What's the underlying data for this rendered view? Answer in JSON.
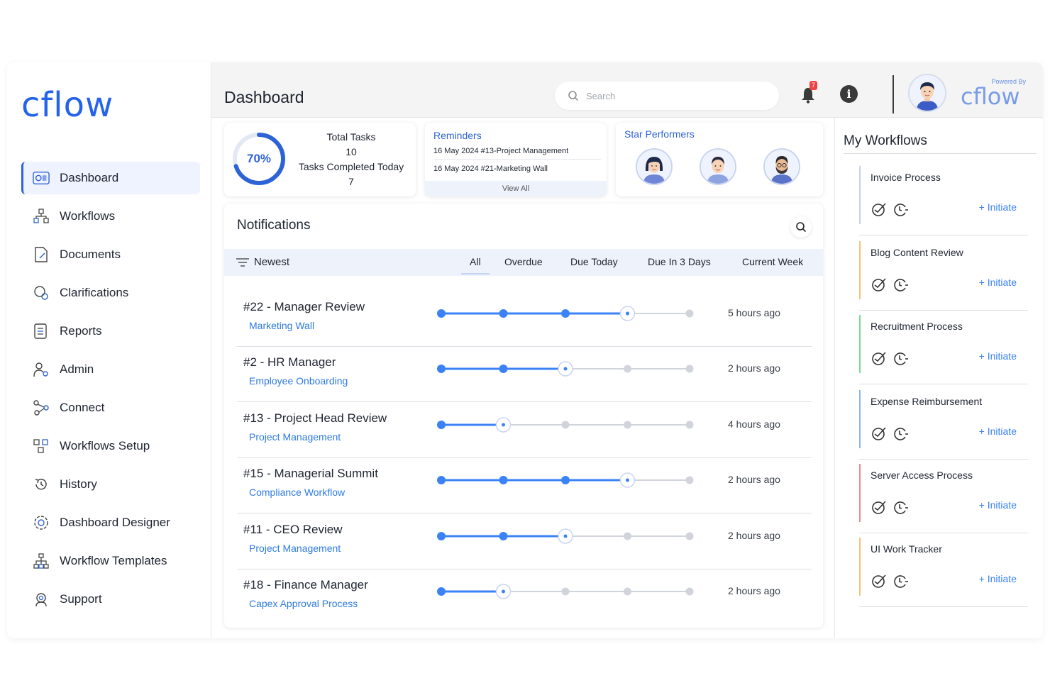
{
  "brand": {
    "logo": "cflow",
    "powered_by": "Powered By",
    "powered_logo": "cflow"
  },
  "sidebar": {
    "items": [
      {
        "label": "Dashboard",
        "icon": "dashboard-icon",
        "active": true
      },
      {
        "label": "Workflows",
        "icon": "workflows-icon"
      },
      {
        "label": "Documents",
        "icon": "documents-icon"
      },
      {
        "label": "Clarifications",
        "icon": "clarifications-icon"
      },
      {
        "label": "Reports",
        "icon": "reports-icon"
      },
      {
        "label": "Admin",
        "icon": "admin-icon"
      },
      {
        "label": "Connect",
        "icon": "connect-icon"
      },
      {
        "label": "Workflows Setup",
        "icon": "workflows-setup-icon"
      },
      {
        "label": "History",
        "icon": "history-icon"
      },
      {
        "label": "Dashboard Designer",
        "icon": "dashboard-designer-icon"
      },
      {
        "label": "Workflow Templates",
        "icon": "workflow-templates-icon"
      },
      {
        "label": "Support",
        "icon": "support-icon"
      }
    ]
  },
  "header": {
    "title": "Dashboard",
    "search_placeholder": "Search",
    "notification_count": "7"
  },
  "tasks": {
    "percent_label": "70%",
    "percent": 70,
    "total_label": "Total Tasks",
    "total": "10",
    "completed_label": "Tasks Completed Today",
    "completed": "7"
  },
  "reminders": {
    "title": "Reminders",
    "items": [
      "16 May 2024 #13-Project Management",
      "16 May 2024 #21-Marketing Wall"
    ],
    "view_all": "View All"
  },
  "star_performers": {
    "title": "Star Performers"
  },
  "notifications": {
    "title": "Notifications",
    "sort_label": "Newest",
    "tabs": [
      "All",
      "Overdue",
      "Due Today",
      "Due In 3 Days",
      "Current Week"
    ],
    "rows": [
      {
        "title": "#22 - Manager Review",
        "subtitle": "Marketing Wall",
        "time": "5 hours ago",
        "step": 4
      },
      {
        "title": "#2 - HR Manager",
        "subtitle": "Employee Onboarding",
        "time": "2 hours ago",
        "step": 3
      },
      {
        "title": "#13 - Project Head Review",
        "subtitle": "Project Management",
        "time": "4 hours ago",
        "step": 2
      },
      {
        "title": "#15 - Managerial Summit",
        "subtitle": "Compliance Workflow",
        "time": "2 hours ago",
        "step": 4
      },
      {
        "title": "#11 - CEO Review",
        "subtitle": "Project Management",
        "time": "2 hours ago",
        "step": 3
      },
      {
        "title": "#18 - Finance Manager",
        "subtitle": "Capex Approval Process",
        "time": "2 hours ago",
        "step": 2
      }
    ],
    "total_steps": 5
  },
  "my_workflows": {
    "title": "My Workflows",
    "initiate_label": "+ Initiate",
    "items": [
      {
        "name": "Invoice Process",
        "color": "#c7d2e8"
      },
      {
        "name": "Blog Content Review",
        "color": "#f5c27a"
      },
      {
        "name": "Recruitment Process",
        "color": "#7fd88f"
      },
      {
        "name": "Expense Reimbursement",
        "color": "#8fb3f0"
      },
      {
        "name": "Server Access Process",
        "color": "#ef8a8a"
      },
      {
        "name": "UI Work Tracker",
        "color": "#f5c27a"
      }
    ]
  },
  "colors": {
    "accent": "#2e63d6",
    "link": "#2e7be0",
    "progress": "#3b82f6",
    "progress_inactive": "#d1d5db"
  }
}
